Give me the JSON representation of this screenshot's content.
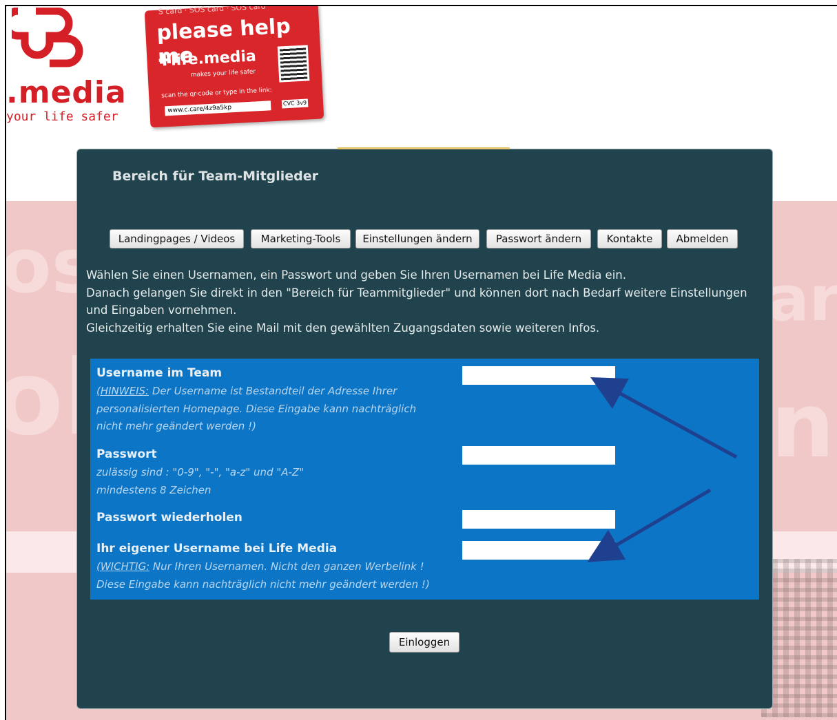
{
  "logo": {
    "wordmark": ".media",
    "tagline": "your life safer"
  },
  "sos_card": {
    "top_text": "S card · SOS card · SOS card",
    "headline": "please help me",
    "brand": "life.media",
    "brand_tagline": "makes your life safer",
    "scan_text": "scan the qr-code or type in the link:",
    "link": "www.c.care/4z9a5kp",
    "cvc": "CVC 3v9"
  },
  "panel": {
    "title": "Bereich für Team-Mitglieder"
  },
  "nav": {
    "items": [
      {
        "label": "Landingpages / Videos"
      },
      {
        "label": "Marketing-Tools"
      },
      {
        "label": "Einstellungen ändern"
      },
      {
        "label": "Passwort ändern"
      },
      {
        "label": "Kontakte"
      },
      {
        "label": "Abmelden"
      }
    ]
  },
  "intro": {
    "line1": "Wählen Sie einen Usernamen, ein Passwort und geben Sie Ihren Usernamen bei Life Media ein.",
    "line2": "Danach gelangen Sie direkt in den \"Bereich für Teammitglieder\" und können dort nach Bedarf weitere Einstellungen und Eingaben vornehmen.",
    "line3": "Gleichzeitig erhalten Sie eine Mail mit den gewählten Zugangsdaten sowie weiteren Infos."
  },
  "form": {
    "username": {
      "label": "Username im Team",
      "hint_prefix": "(HINWEIS:",
      "hint_text": " Der Username ist Bestandteil der Adresse Ihrer personalisierten Homepage. Diese Eingabe kann nachträglich nicht mehr geändert werden !)",
      "value": ""
    },
    "password": {
      "label": "Passwort",
      "hint_line1": "zulässig sind : \"0-9\", \"-\", \"a-z\" und \"A-Z\"",
      "hint_line2": "mindestens 8 Zeichen",
      "value": ""
    },
    "password_repeat": {
      "label": "Passwort wiederholen",
      "value": ""
    },
    "lifemedia_username": {
      "label": "Ihr eigener Username bei Life Media",
      "hint_prefix": "(WICHTIG:",
      "hint_text": " Nur Ihren Usernamen. Nicht den ganzen Werbelink !",
      "hint_line2": "Diese Eingabe kann nachträglich nicht mehr geändert werden !)",
      "value": ""
    },
    "submit_label": "Einloggen"
  },
  "colors": {
    "brand_red": "#d51f26",
    "panel_bg": "#21434d",
    "form_bg": "#0c75c6",
    "arrow": "#1f3f8f"
  },
  "icons": [
    "life-media-logo-icon",
    "qr-code-icon",
    "arrow-annotation-icon"
  ]
}
